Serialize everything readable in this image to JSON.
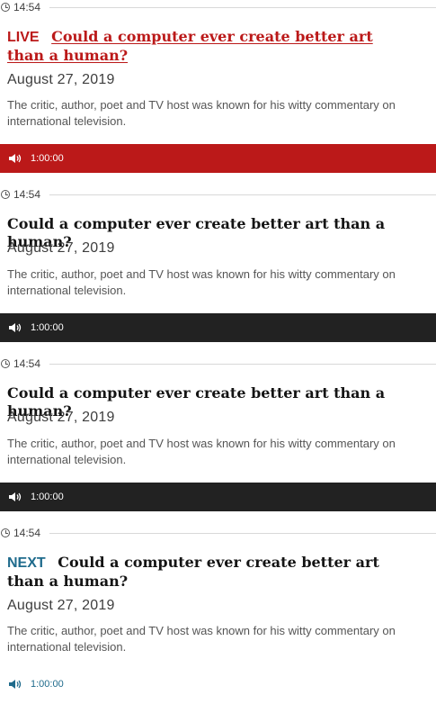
{
  "items": [
    {
      "time": "14:54",
      "badge": "LIVE",
      "title": "Could a computer ever create better art than a human?",
      "date": "August 27, 2019",
      "description": "The critic, author, poet and TV host was known for his witty commentary on international television.",
      "duration": "1:00:00"
    },
    {
      "time": "14:54",
      "badge": "",
      "title": "Could a computer ever create better art than a human?",
      "date": "August 27, 2019",
      "description": "The critic, author, poet and TV host was known for his witty commentary on international television.",
      "duration": "1:00:00"
    },
    {
      "time": "14:54",
      "badge": "",
      "title": "Could a computer ever create better art than a human?",
      "date": "August 27, 2019",
      "description": "The critic, author, poet and TV host was known for his witty commentary on international television.",
      "duration": "1:00:00"
    },
    {
      "time": "14:54",
      "badge": "NEXT",
      "title": "Could a computer ever create better art than a human?",
      "date": "August 27, 2019",
      "description": "The critic, author, poet and TV host was known for his witty commentary on international television.",
      "duration": "1:00:00"
    }
  ],
  "colors": {
    "live": "#bb1919",
    "next": "#1f6b8c",
    "player_dark": "#222222"
  },
  "icons": {
    "clock": "clock-icon",
    "speaker": "speaker-icon"
  }
}
